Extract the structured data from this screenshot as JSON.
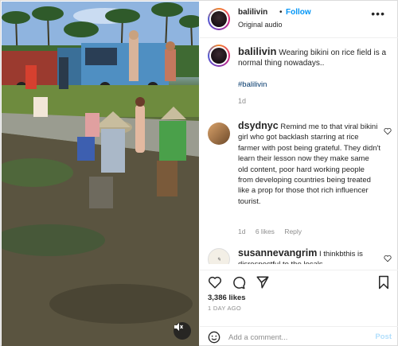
{
  "post": {
    "username": "balilivin",
    "separator": "•",
    "follow_label": "Follow",
    "audio_label": "Original audio",
    "more_icon": "more-horizontal-icon"
  },
  "caption": {
    "username": "balilivin",
    "text": "Wearing bikini on rice field is a normal thing nowadays..",
    "hashtag": "#balilivin",
    "time": "1d"
  },
  "comments": [
    {
      "username": "dsydnyc",
      "text": "Remind me to that viral bikini girl who got backlash starring at rice farmer with post being grateful. They didn't learn their lesson now they make same old content, poor hard working people from developing countries being treated like a prop for those thot rich influencer tourist.",
      "time": "1d",
      "likes": "6 likes",
      "reply_label": "Reply"
    },
    {
      "username": "susannevangrim",
      "text": "I thinkbthis is disrespectful to the locals"
    }
  ],
  "actions": {
    "like_icon": "heart-icon",
    "comment_icon": "comment-icon",
    "share_icon": "send-icon",
    "save_icon": "bookmark-icon"
  },
  "stats": {
    "likes": "3,386 likes",
    "date": "1 DAY AGO"
  },
  "add_comment": {
    "placeholder": "Add a comment...",
    "post_label": "Post"
  },
  "media": {
    "mute_icon": "speaker-muted-icon"
  },
  "colors": {
    "accent": "#0095f6",
    "post_disabled": "#b2dffc",
    "muted_text": "#8e8e8e",
    "hashtag": "#00376b"
  }
}
